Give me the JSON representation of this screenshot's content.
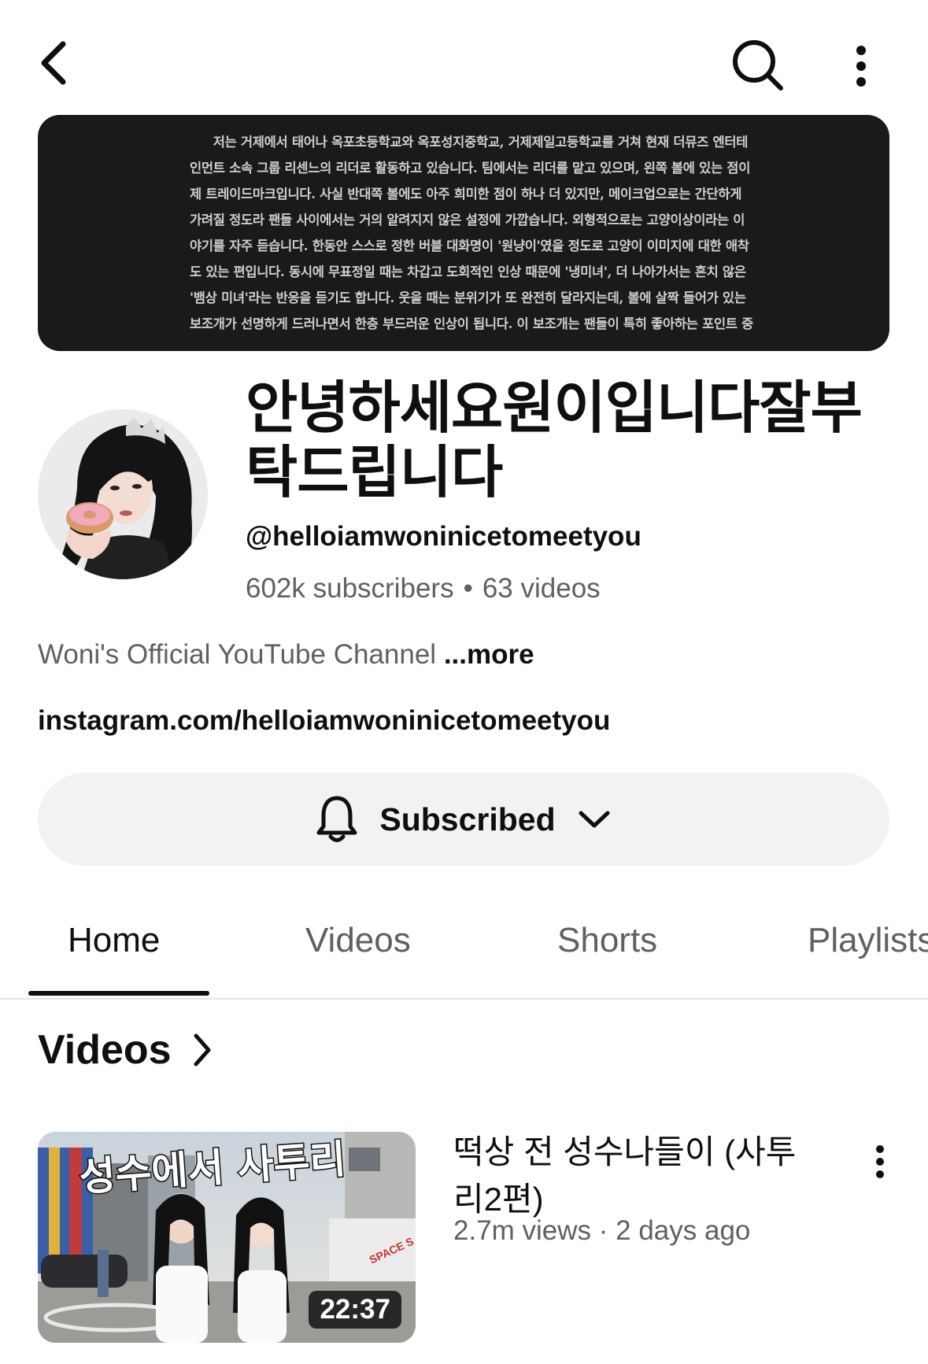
{
  "banner": {
    "text": "저는 거제에서 태어나 옥포초등학교와 옥포성지중학교, 거제제일고등학교를 거쳐 현재 더뮤즈 엔터테인먼트 소속 그룹 리센느의 리더로 활동하고 있습니다. 팀에서는 리더를 맡고 있으며, 왼쪽 볼에 있는 점이 제 트레이드마크입니다. 사실 반대쪽 볼에도 아주 희미한 점이 하나 더 있지만, 메이크업으로는 간단하게 가려질 정도라 팬들 사이에서는 거의 알려지지 않은 설정에 가깝습니다. 외형적으로는 고양이상이라는 이야기를 자주 듣습니다. 한동안 스스로 정한 버블 대화명이 '원냥이'였을 정도로 고양이 이미지에 대한 애착도 있는 편입니다. 동시에 무표정일 때는 차갑고 도회적인 인상 때문에 '냉미녀', 더 나아가서는 흔치 않은 '뱀상 미녀'라는 반응을 듣기도 합니다. 웃을 때는 분위기가 또 완전히 달라지는데, 볼에 살짝 들어가 있는 보조개가 선명하게 드러나면서 한층 부드러운 인상이 됩니다. 이 보조개는 팬들이 특히 좋아하는 포인트 중"
  },
  "channel": {
    "name": "안녕하세요원이입니다잘부탁드립니다",
    "handle": "@helloiamwoninicetomeetyou",
    "subscribers": "602k subscribers",
    "videos_count": "63 videos",
    "stats_separator": "•",
    "description": "Woni's Official YouTube Channel",
    "more_label": "...more",
    "link": "instagram.com/helloiamwoninicetomeetyou"
  },
  "subscribe": {
    "label": "Subscribed"
  },
  "tabs": [
    {
      "label": "Home",
      "active": true
    },
    {
      "label": "Videos",
      "active": false
    },
    {
      "label": "Shorts",
      "active": false
    },
    {
      "label": "Playlists",
      "active": false
    }
  ],
  "section": {
    "title": "Videos"
  },
  "videos": [
    {
      "title": "떡상 전 성수나들이 (사투리2편)",
      "meta": "2.7m views · 2 days ago",
      "duration": "22:37",
      "thumbnail_caption": "성수에서 사투리",
      "thumbnail_sign": "SPACE S"
    }
  ],
  "icons": {
    "back": "chevron-left-icon",
    "search": "search-icon",
    "more": "more-vertical-icon",
    "bell": "bell-icon",
    "dropdown": "chevron-down-icon",
    "section_arrow": "chevron-right-icon"
  }
}
